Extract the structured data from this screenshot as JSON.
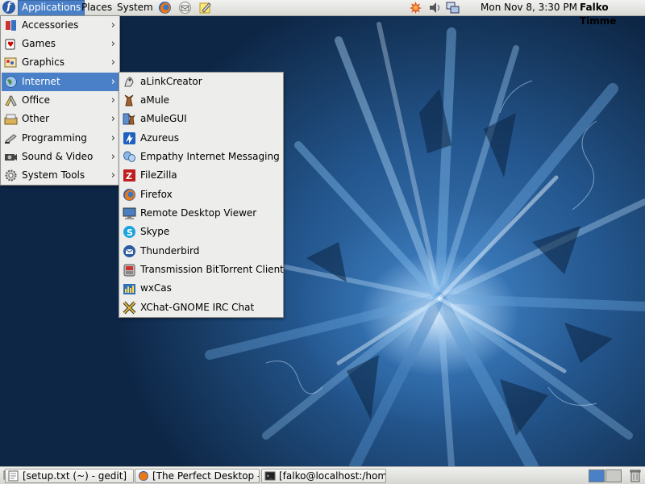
{
  "top_panel": {
    "menus": {
      "applications": "Applications",
      "places": "Places",
      "system": "System"
    },
    "clock": "Mon Nov  8,  3:30 PM",
    "user": "Falko Timme",
    "logo_letter": "f"
  },
  "applications_menu": {
    "items": [
      {
        "label": "Accessories",
        "icon": "accessories-icon"
      },
      {
        "label": "Games",
        "icon": "games-icon"
      },
      {
        "label": "Graphics",
        "icon": "graphics-icon"
      },
      {
        "label": "Internet",
        "icon": "internet-icon",
        "active": true
      },
      {
        "label": "Office",
        "icon": "office-icon"
      },
      {
        "label": "Other",
        "icon": "other-icon"
      },
      {
        "label": "Programming",
        "icon": "programming-icon"
      },
      {
        "label": "Sound & Video",
        "icon": "sound-video-icon"
      },
      {
        "label": "System Tools",
        "icon": "system-tools-icon"
      }
    ],
    "arrow": "›"
  },
  "internet_menu": {
    "items": [
      {
        "label": "aLinkCreator",
        "icon": "alinkcreator-icon"
      },
      {
        "label": "aMule",
        "icon": "amule-icon"
      },
      {
        "label": "aMuleGUI",
        "icon": "amulegui-icon"
      },
      {
        "label": "Azureus",
        "icon": "azureus-icon"
      },
      {
        "label": "Empathy Internet Messaging",
        "icon": "empathy-icon"
      },
      {
        "label": "FileZilla",
        "icon": "filezilla-icon"
      },
      {
        "label": "Firefox",
        "icon": "firefox-icon"
      },
      {
        "label": "Remote Desktop Viewer",
        "icon": "remote-desktop-icon"
      },
      {
        "label": "Skype",
        "icon": "skype-icon"
      },
      {
        "label": "Thunderbird",
        "icon": "thunderbird-icon"
      },
      {
        "label": "Transmission BitTorrent Client",
        "icon": "transmission-icon"
      },
      {
        "label": "wxCas",
        "icon": "wxcas-icon"
      },
      {
        "label": "XChat-GNOME IRC Chat",
        "icon": "xchat-icon"
      }
    ]
  },
  "taskbar": {
    "tasks": [
      {
        "label": "[setup.txt (~) - gedit]",
        "icon": "gedit-icon"
      },
      {
        "label": "[The Perfect Desktop -...",
        "icon": "firefox-icon"
      },
      {
        "label": "[falko@localhost:/hom...",
        "icon": "terminal-icon"
      }
    ]
  },
  "colors": {
    "menu_highlight": "#4a80c7",
    "panel_bg": "#e6e6e3",
    "menu_bg": "#ededeb"
  }
}
